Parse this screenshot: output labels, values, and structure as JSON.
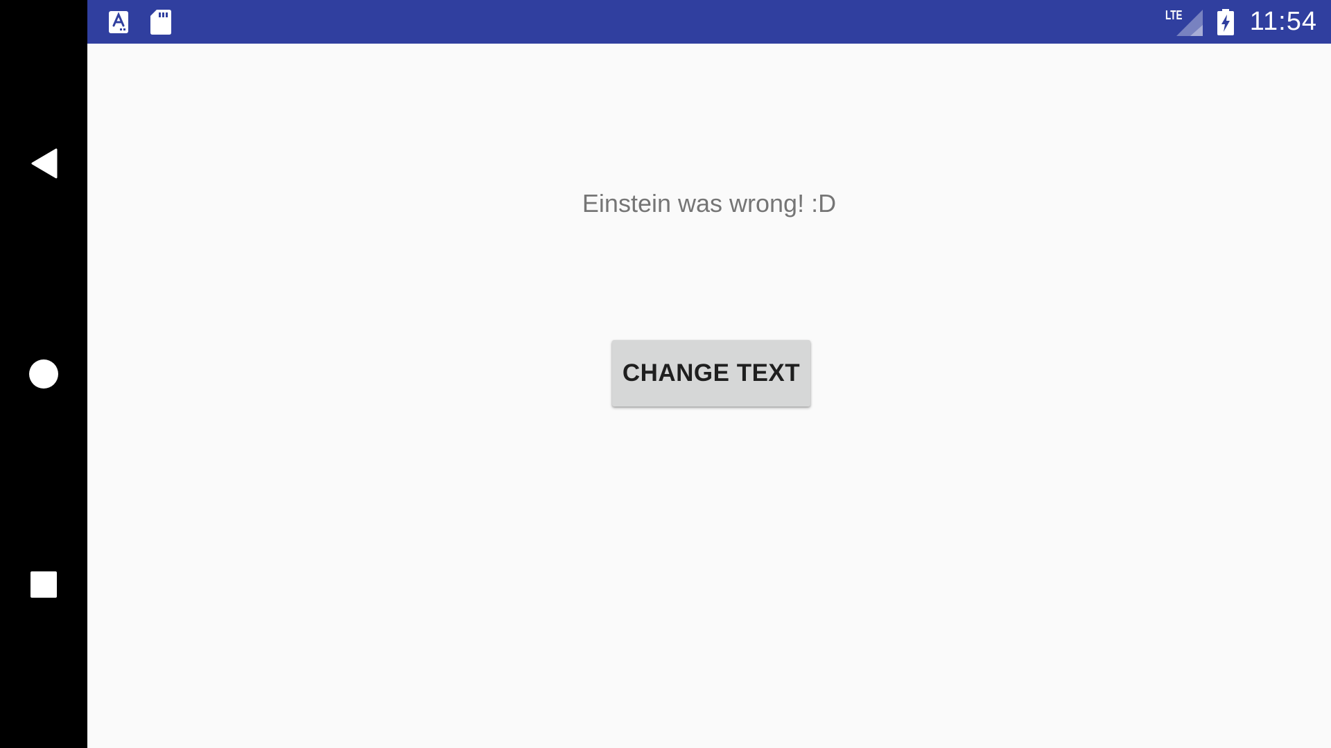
{
  "status_bar": {
    "time": "11:54",
    "network_label": "LTE",
    "icons": [
      "text-input-icon",
      "sd-card-icon",
      "signal-icon",
      "battery-charging-icon"
    ],
    "background_color": "#303f9f"
  },
  "navigation": {
    "buttons": [
      {
        "name": "back",
        "icon": "back-triangle-icon"
      },
      {
        "name": "home",
        "icon": "home-circle-icon"
      },
      {
        "name": "recents",
        "icon": "recents-square-icon"
      }
    ]
  },
  "main": {
    "message": "Einstein was wrong! :D",
    "button_label": "CHANGE TEXT",
    "background_color": "#fafafa",
    "button_color": "#d6d7d7"
  }
}
